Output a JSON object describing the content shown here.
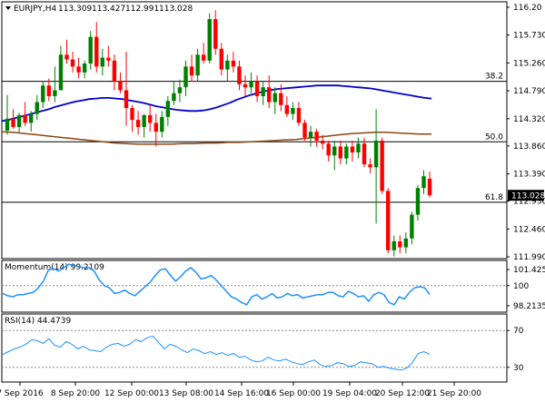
{
  "chart_data": [
    {
      "type": "candlestick",
      "title": "EURJPY,H4",
      "ohlc_header": [
        "113.309",
        "113.427",
        "112.991",
        "113.028"
      ],
      "ylim": [
        111.99,
        116.2
      ],
      "y_ticks": [
        "116.20",
        "115.730",
        "115.260",
        "114.790",
        "114.320",
        "113.860",
        "113.390",
        "112.930",
        "112.460",
        "111.990"
      ],
      "last_price": "113.028",
      "colors": {
        "up": "#008000",
        "down": "#ff0000",
        "ma_fast": "#0000cd",
        "ma_slow": "#8b4513",
        "last_price_bg": "#000000"
      },
      "fib_levels": [
        {
          "label": "38.2",
          "value": 114.95
        },
        {
          "label": "50.0",
          "value": 113.93
        },
        {
          "label": "61.8",
          "value": 112.91
        }
      ],
      "candles": [
        {
          "o": 114.12,
          "h": 114.72,
          "l": 114.05,
          "c": 114.32
        },
        {
          "o": 114.32,
          "h": 114.48,
          "l": 114.15,
          "c": 114.18
        },
        {
          "o": 114.18,
          "h": 114.42,
          "l": 114.08,
          "c": 114.38
        },
        {
          "o": 114.38,
          "h": 114.6,
          "l": 114.2,
          "c": 114.25
        },
        {
          "o": 114.25,
          "h": 114.45,
          "l": 114.1,
          "c": 114.4
        },
        {
          "o": 114.4,
          "h": 114.72,
          "l": 114.3,
          "c": 114.6
        },
        {
          "o": 114.6,
          "h": 114.95,
          "l": 114.5,
          "c": 114.88
        },
        {
          "o": 114.88,
          "h": 115.0,
          "l": 114.62,
          "c": 114.7
        },
        {
          "o": 114.7,
          "h": 115.2,
          "l": 114.6,
          "c": 114.8
        },
        {
          "o": 114.8,
          "h": 115.55,
          "l": 114.8,
          "c": 115.4
        },
        {
          "o": 115.4,
          "h": 115.65,
          "l": 115.25,
          "c": 115.32
        },
        {
          "o": 115.32,
          "h": 115.45,
          "l": 115.1,
          "c": 115.2
        },
        {
          "o": 115.2,
          "h": 115.35,
          "l": 115.0,
          "c": 115.1
        },
        {
          "o": 115.1,
          "h": 115.3,
          "l": 115.0,
          "c": 115.25
        },
        {
          "o": 115.25,
          "h": 115.8,
          "l": 115.15,
          "c": 115.7
        },
        {
          "o": 115.7,
          "h": 115.95,
          "l": 115.1,
          "c": 115.2
        },
        {
          "o": 115.2,
          "h": 115.5,
          "l": 115.05,
          "c": 115.35
        },
        {
          "o": 115.35,
          "h": 115.55,
          "l": 115.2,
          "c": 115.3
        },
        {
          "o": 115.3,
          "h": 115.4,
          "l": 114.8,
          "c": 114.95
        },
        {
          "o": 114.95,
          "h": 115.1,
          "l": 114.75,
          "c": 114.8
        },
        {
          "o": 114.8,
          "h": 115.45,
          "l": 114.2,
          "c": 114.5
        },
        {
          "o": 114.5,
          "h": 114.55,
          "l": 114.1,
          "c": 114.3
        },
        {
          "o": 114.3,
          "h": 114.45,
          "l": 114.05,
          "c": 114.18
        },
        {
          "o": 114.18,
          "h": 114.4,
          "l": 114.0,
          "c": 114.38
        },
        {
          "o": 114.38,
          "h": 114.55,
          "l": 114.1,
          "c": 114.25
        },
        {
          "o": 114.25,
          "h": 114.4,
          "l": 113.85,
          "c": 114.1
        },
        {
          "o": 114.1,
          "h": 114.45,
          "l": 114.0,
          "c": 114.35
        },
        {
          "o": 114.35,
          "h": 114.7,
          "l": 114.2,
          "c": 114.62
        },
        {
          "o": 114.62,
          "h": 114.95,
          "l": 114.55,
          "c": 114.75
        },
        {
          "o": 114.75,
          "h": 114.98,
          "l": 114.6,
          "c": 114.85
        },
        {
          "o": 114.85,
          "h": 115.3,
          "l": 114.7,
          "c": 115.2
        },
        {
          "o": 115.2,
          "h": 115.4,
          "l": 114.95,
          "c": 115.05
        },
        {
          "o": 115.05,
          "h": 115.5,
          "l": 114.95,
          "c": 115.4
        },
        {
          "o": 115.4,
          "h": 115.6,
          "l": 115.25,
          "c": 115.3
        },
        {
          "o": 115.3,
          "h": 116.1,
          "l": 115.25,
          "c": 116.0
        },
        {
          "o": 116.0,
          "h": 116.15,
          "l": 115.4,
          "c": 115.5
        },
        {
          "o": 115.5,
          "h": 115.6,
          "l": 115.05,
          "c": 115.15
        },
        {
          "o": 115.15,
          "h": 115.4,
          "l": 114.95,
          "c": 115.3
        },
        {
          "o": 115.3,
          "h": 115.45,
          "l": 115.1,
          "c": 115.2
        },
        {
          "o": 115.2,
          "h": 115.3,
          "l": 114.8,
          "c": 114.9
        },
        {
          "o": 114.9,
          "h": 115.05,
          "l": 114.7,
          "c": 114.85
        },
        {
          "o": 114.85,
          "h": 115.1,
          "l": 114.75,
          "c": 114.95
        },
        {
          "o": 114.95,
          "h": 115.05,
          "l": 114.6,
          "c": 114.7
        },
        {
          "o": 114.7,
          "h": 114.95,
          "l": 114.55,
          "c": 114.85
        },
        {
          "o": 114.85,
          "h": 115.05,
          "l": 114.5,
          "c": 114.6
        },
        {
          "o": 114.6,
          "h": 114.85,
          "l": 114.4,
          "c": 114.75
        },
        {
          "o": 114.75,
          "h": 114.9,
          "l": 114.45,
          "c": 114.55
        },
        {
          "o": 114.55,
          "h": 114.7,
          "l": 114.35,
          "c": 114.4
        },
        {
          "o": 114.4,
          "h": 114.6,
          "l": 114.3,
          "c": 114.5
        },
        {
          "o": 114.5,
          "h": 114.6,
          "l": 114.2,
          "c": 114.25
        },
        {
          "o": 114.25,
          "h": 114.3,
          "l": 113.95,
          "c": 114.0
        },
        {
          "o": 114.0,
          "h": 114.2,
          "l": 113.85,
          "c": 114.1
        },
        {
          "o": 114.1,
          "h": 114.15,
          "l": 113.85,
          "c": 113.95
        },
        {
          "o": 113.95,
          "h": 114.05,
          "l": 113.8,
          "c": 113.9
        },
        {
          "o": 113.9,
          "h": 113.95,
          "l": 113.6,
          "c": 113.7
        },
        {
          "o": 113.7,
          "h": 113.95,
          "l": 113.45,
          "c": 113.85
        },
        {
          "o": 113.85,
          "h": 113.95,
          "l": 113.55,
          "c": 113.65
        },
        {
          "o": 113.65,
          "h": 113.9,
          "l": 113.55,
          "c": 113.85
        },
        {
          "o": 113.85,
          "h": 113.95,
          "l": 113.6,
          "c": 113.75
        },
        {
          "o": 113.75,
          "h": 114.0,
          "l": 113.65,
          "c": 113.9
        },
        {
          "o": 113.9,
          "h": 114.0,
          "l": 113.5,
          "c": 113.55
        },
        {
          "o": 113.55,
          "h": 113.65,
          "l": 113.4,
          "c": 113.5
        },
        {
          "o": 113.5,
          "h": 114.48,
          "l": 112.55,
          "c": 113.95
        },
        {
          "o": 113.95,
          "h": 114.0,
          "l": 113.05,
          "c": 113.1
        },
        {
          "o": 113.1,
          "h": 113.15,
          "l": 112.05,
          "c": 112.1
        },
        {
          "o": 112.1,
          "h": 112.35,
          "l": 112.0,
          "c": 112.25
        },
        {
          "o": 112.25,
          "h": 112.35,
          "l": 112.05,
          "c": 112.15
        },
        {
          "o": 112.15,
          "h": 112.4,
          "l": 112.05,
          "c": 112.3
        },
        {
          "o": 112.3,
          "h": 112.75,
          "l": 112.2,
          "c": 112.7
        },
        {
          "o": 112.7,
          "h": 113.2,
          "l": 112.6,
          "c": 113.15
        },
        {
          "o": 113.15,
          "h": 113.45,
          "l": 113.05,
          "c": 113.35
        },
        {
          "o": 113.309,
          "h": 113.427,
          "l": 112.991,
          "c": 113.028
        }
      ],
      "ma_fast_values": [
        114.28,
        114.3,
        114.33,
        114.36,
        114.39,
        114.42,
        114.45,
        114.48,
        114.52,
        114.55,
        114.58,
        114.61,
        114.63,
        114.65,
        114.66,
        114.67,
        114.67,
        114.66,
        114.65,
        114.63,
        114.61,
        114.59,
        114.56,
        114.53,
        114.51,
        114.49,
        114.47,
        114.46,
        114.45,
        114.45,
        114.46,
        114.48,
        114.51,
        114.55,
        114.59,
        114.64,
        114.68,
        114.72,
        114.75,
        114.78,
        114.8,
        114.82,
        114.83,
        114.84,
        114.85,
        114.86,
        114.87,
        114.88,
        114.88,
        114.88,
        114.88,
        114.87,
        114.86,
        114.85,
        114.84,
        114.83,
        114.81,
        114.79,
        114.77,
        114.75,
        114.73,
        114.71,
        114.69,
        114.67,
        114.66
      ],
      "ma_slow_values": [
        114.1,
        114.09,
        114.07,
        114.05,
        114.03,
        114.01,
        113.99,
        113.97,
        113.95,
        113.93,
        113.91,
        113.9,
        113.89,
        113.89,
        113.89,
        113.89,
        113.9,
        113.9,
        113.91,
        113.91,
        113.92,
        113.92,
        113.93,
        113.94,
        113.95,
        113.96,
        113.97,
        113.99,
        114.01,
        114.03,
        114.05,
        114.07,
        114.08,
        114.09,
        114.09,
        114.08,
        114.07,
        114.06,
        114.06
      ],
      "x_ticks": [
        "7 Sep 2016",
        "8 Sep 20:00",
        "12 Sep 00:00",
        "13 Sep 08:00",
        "14 Sep 16:00",
        "16 Sep 00:00",
        "19 Sep 04:00",
        "20 Sep 12:00",
        "21 Sep 20:00"
      ]
    },
    {
      "type": "line",
      "title": "Momentum(14) 99.2109",
      "ylim": [
        97.8,
        102.0
      ],
      "y_ticks": [
        "101.4257",
        "100",
        "98.2135"
      ],
      "reference_level": 100,
      "color": "#1e90ff",
      "values": [
        99.3,
        99.1,
        99.0,
        99.2,
        99.2,
        99.3,
        99.4,
        99.8,
        100.4,
        101.4,
        101.5,
        101.3,
        101.6,
        101.9,
        101.8,
        101.7,
        101.6,
        101.6,
        101.3,
        100.5,
        100.0,
        99.8,
        99.3,
        99.4,
        99.6,
        99.3,
        99.1,
        99.5,
        99.9,
        100.3,
        100.9,
        101.4,
        101.5,
        100.9,
        100.4,
        100.8,
        101.3,
        101.6,
        101.2,
        100.6,
        100.7,
        100.9,
        100.5,
        100.0,
        99.5,
        99.0,
        98.8,
        98.5,
        98.3,
        99.0,
        99.2,
        98.8,
        99.0,
        99.3,
        98.9,
        99.0,
        99.3,
        99.1,
        99.2,
        98.9,
        99.0,
        99.1,
        99.2,
        99.2,
        99.4,
        99.4,
        99.1,
        99.0,
        99.5,
        99.3,
        99.0,
        99.1,
        98.6,
        99.2,
        99.4,
        99.2,
        98.5,
        98.3,
        99.0,
        98.8,
        99.4,
        99.8,
        99.9,
        99.8,
        99.2
      ]
    },
    {
      "type": "line",
      "title": "RSI(14) 44.4739",
      "ylim": [
        16,
        84
      ],
      "y_ticks": [
        "70",
        "30"
      ],
      "reference_levels": [
        70,
        30
      ],
      "color": "#1e90ff",
      "values": [
        44,
        47,
        50,
        52,
        55,
        60,
        59,
        56,
        61,
        54,
        52,
        58,
        55,
        50,
        53,
        49,
        48,
        47,
        52,
        55,
        56,
        53,
        55,
        60,
        58,
        62,
        64,
        57,
        50,
        55,
        53,
        49,
        46,
        50,
        48,
        45,
        47,
        44,
        46,
        43,
        45,
        41,
        42,
        38,
        36,
        37,
        41,
        38,
        37,
        39,
        36,
        34,
        33,
        36,
        38,
        33,
        31,
        32,
        35,
        34,
        31,
        32,
        36,
        35,
        34,
        30,
        31,
        29,
        28,
        27,
        29,
        35,
        45,
        47,
        44
      ]
    }
  ]
}
